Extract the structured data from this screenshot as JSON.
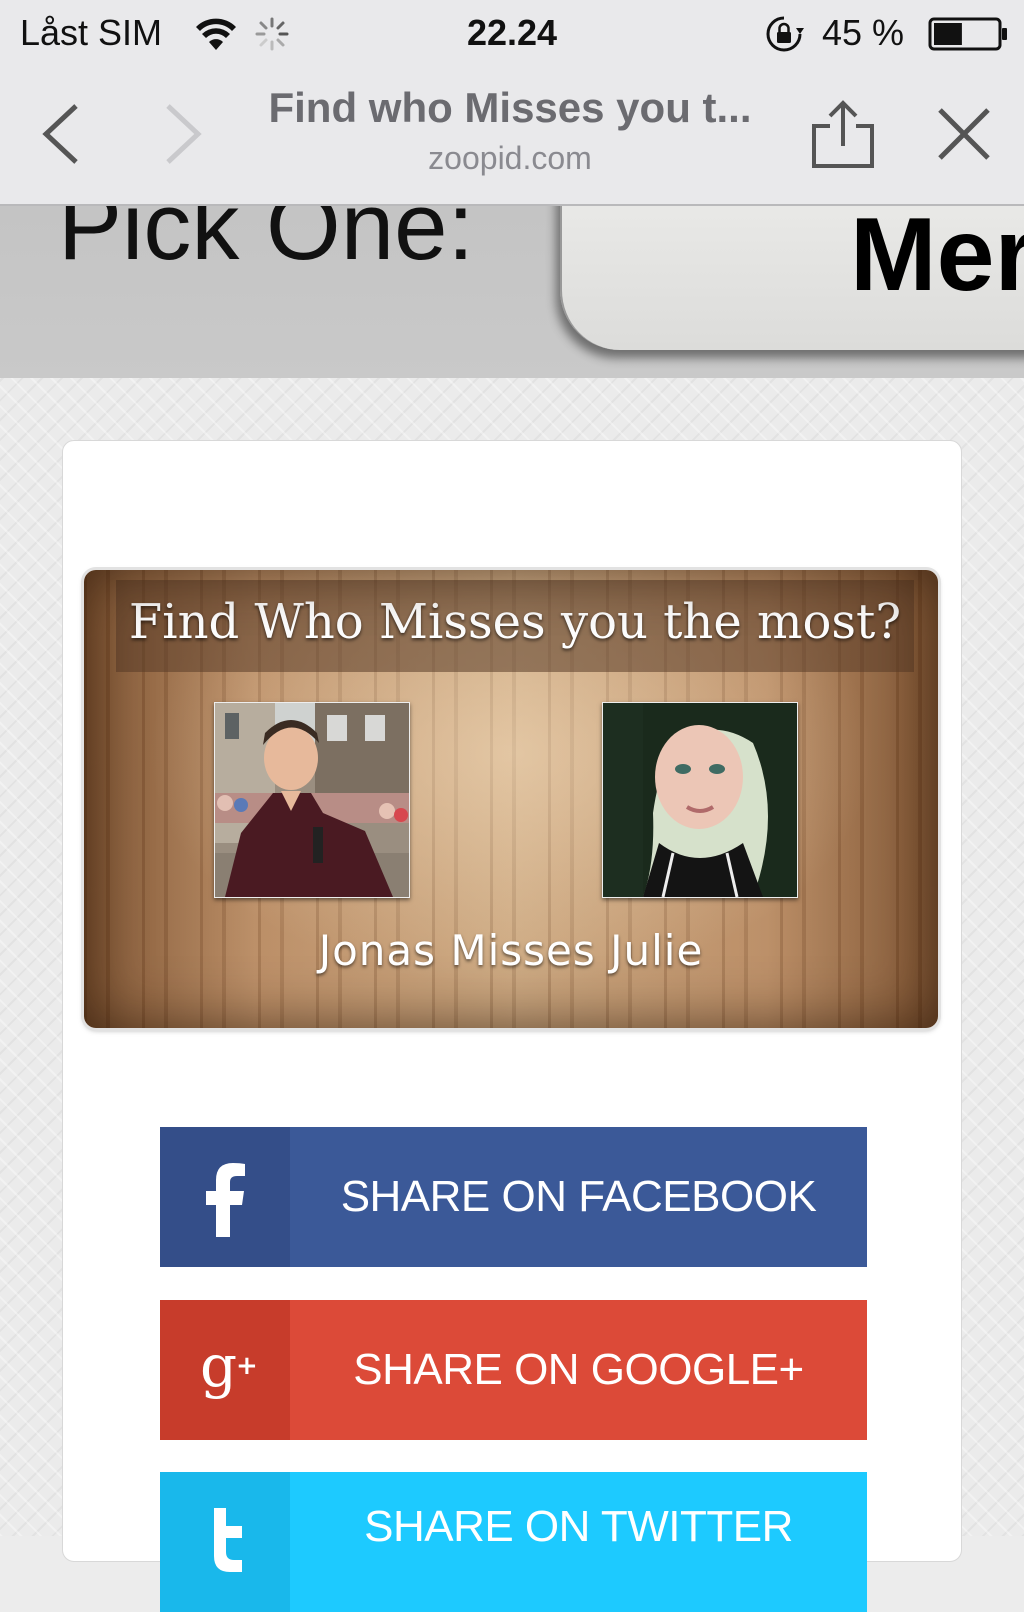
{
  "status_bar": {
    "carrier": "Låst SIM",
    "time": "22.24",
    "battery_percent": "45 %",
    "battery_level": 0.45
  },
  "browser": {
    "page_title": "Find who Misses you t...",
    "domain": "zoopid.com"
  },
  "header": {
    "pick_label": "Pick One:",
    "tab_text": "Mer"
  },
  "result_card": {
    "title": "Find Who Misses you the most?",
    "caption": "Jonas Misses Julie"
  },
  "share_buttons": {
    "facebook": "SHARE ON FACEBOOK",
    "google": "SHARE ON GOOGLE+",
    "twitter": "SHARE ON TWITTER"
  },
  "colors": {
    "facebook": "#3b5998",
    "google": "#dc4a38",
    "twitter": "#1dcaff"
  },
  "icons": {
    "back": "chevron-left-icon",
    "forward": "chevron-right-icon",
    "share": "share-icon",
    "close": "close-icon",
    "facebook": "facebook-icon",
    "google": "google-plus-icon",
    "twitter": "twitter-icon"
  }
}
